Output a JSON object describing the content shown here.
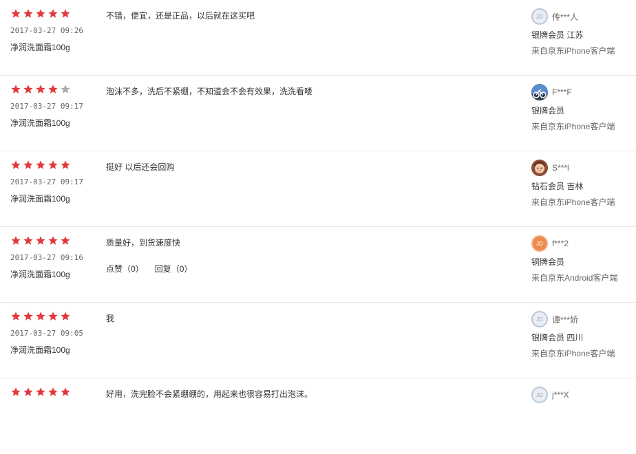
{
  "colors": {
    "star_on": "#e4393c",
    "star_off": "#aaaaaa",
    "divider": "#e4e4e4"
  },
  "reviews": [
    {
      "rating": 5,
      "time": "2017-03-27 09:26",
      "product": "净润洗面霜100g",
      "content": "不错，便宜，还是正品，以后就在这买吧",
      "user": {
        "avatar": "jd",
        "avatar_text": "JD",
        "nickname": "传***人",
        "level": "银牌会员  江苏",
        "source": "来自京东iPhone客户端"
      }
    },
    {
      "rating": 4,
      "time": "2017-03-27 09:17",
      "product": "净润洗面霜100g",
      "content": "泡沫不多，洗后不紧绷，不知道会不会有效果，洗洗看喽",
      "user": {
        "avatar": "bike",
        "avatar_text": "",
        "nickname": "F***F",
        "level": "银牌会员",
        "source": "来自京东iPhone客户端"
      }
    },
    {
      "rating": 5,
      "time": "2017-03-27 09:17",
      "product": "净润洗面霜100g",
      "content": "挺好 以后还会回购",
      "user": {
        "avatar": "face",
        "avatar_text": "",
        "nickname": "S***l",
        "level": "钻石会员  吉林",
        "source": "来自京东iPhone客户端"
      }
    },
    {
      "rating": 5,
      "time": "2017-03-27 09:16",
      "product": "净润洗面霜100g",
      "content": "质量好，到货速度快",
      "actions": {
        "like": "点赞（0）",
        "reply": "回复（0）"
      },
      "user": {
        "avatar": "orange",
        "avatar_text": "JD",
        "nickname": "f***2",
        "level": "铜牌会员",
        "source": "来自京东Android客户端"
      }
    },
    {
      "rating": 5,
      "time": "2017-03-27 09:05",
      "product": "净润洗面霜100g",
      "content": "我",
      "user": {
        "avatar": "jd",
        "avatar_text": "JD",
        "nickname": "谭***娇",
        "level": "银牌会员  四川",
        "source": "来自京东iPhone客户端"
      }
    },
    {
      "rating": 5,
      "time": "",
      "product": "",
      "content": "好用，洗完脸不会紧绷绷的，用起来也很容易打出泡沫。",
      "user": {
        "avatar": "jd",
        "avatar_text": "JD",
        "nickname": "j***X",
        "level": "",
        "source": ""
      }
    }
  ]
}
